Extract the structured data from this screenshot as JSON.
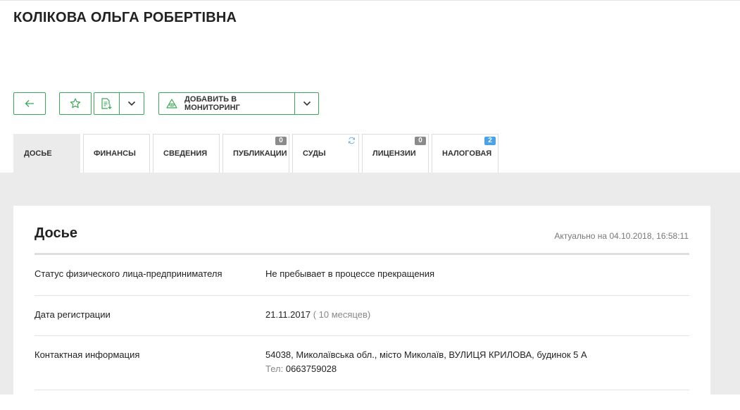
{
  "page": {
    "title": "КОЛІКОВА ОЛЬГА РОБЕРТІВНА"
  },
  "toolbar": {
    "monitor_label": "ДОБАВИТЬ В МОНИТОРИНГ",
    "accent_color": "#3aa856"
  },
  "tabs": [
    {
      "label": "ДОСЬЕ",
      "active": true
    },
    {
      "label": "ФИНАНСЫ"
    },
    {
      "label": "СВЕДЕНИЯ"
    },
    {
      "label": "ПУБЛИКАЦИИ",
      "badge": "0"
    },
    {
      "label": "СУДЫ",
      "icon": "refresh-icon"
    },
    {
      "label": "ЛИЦЕНЗИИ",
      "badge": "0"
    },
    {
      "label": "НАЛОГОВАЯ",
      "badge": "2"
    }
  ],
  "dossier": {
    "title": "Досье",
    "updated": "Актуально на 04.10.2018, 16:58:11",
    "rows": [
      {
        "key": "Статус физического лица-предпринимателя",
        "value": "Не пребывает в процессе прекращения"
      },
      {
        "key": "Дата регистрации",
        "value": "21.11.2017",
        "extra": "( 10 месяцев)"
      },
      {
        "key": "Контактная информация",
        "value": "54038, Миколаївська обл., місто Миколаїв, ВУЛИЦЯ КРИЛОВА, будинок 5 А",
        "phone_label": "Тел:",
        "phone": "0663759028"
      }
    ]
  }
}
